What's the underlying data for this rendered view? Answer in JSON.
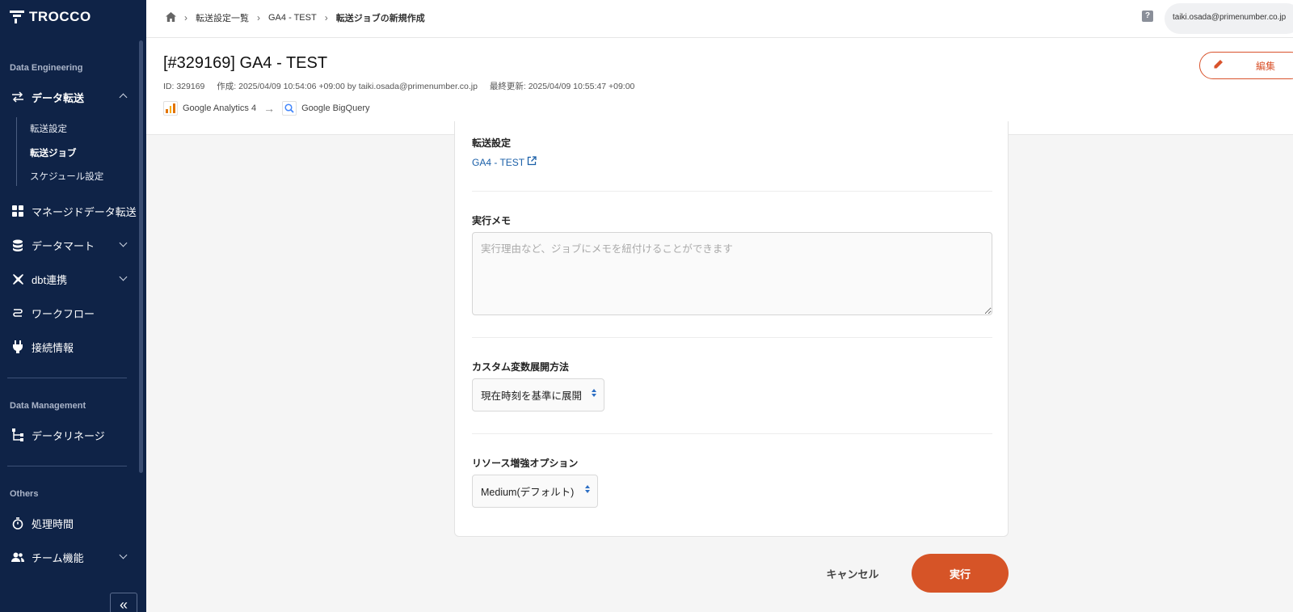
{
  "app": {
    "logo_text": "TROCCO"
  },
  "sidebar": {
    "section_data_engineering": "Data Engineering",
    "section_data_management": "Data Management",
    "section_others": "Others",
    "data_transfer": "データ転送",
    "sub_items": [
      "転送設定",
      "転送ジョブ",
      "スケジュール設定"
    ],
    "managed_transfer": "マネージドデータ転送",
    "data_mart": "データマート",
    "dbt": "dbt連携",
    "workflow": "ワークフロー",
    "connections": "接続情報",
    "lineage": "データリネージ",
    "processing_time": "処理時間",
    "team": "チーム機能",
    "collapse": "«"
  },
  "breadcrumb": {
    "items": [
      "転送設定一覧",
      "GA4 - TEST",
      "転送ジョブの新規作成"
    ]
  },
  "header": {
    "help": "?",
    "user_email": "taiki.osada@primenumber.co.jp",
    "title": "[#329169] GA4 - TEST",
    "meta_id": "ID: 329169",
    "meta_created": "作成: 2025/04/09 10:54:06 +09:00 by taiki.osada@primenumber.co.jp",
    "meta_updated": "最終更新: 2025/04/09 10:55:47 +09:00",
    "source": "Google Analytics 4",
    "destination": "Google BigQuery",
    "edit_label": "編集"
  },
  "form": {
    "transfer_setting_label": "転送設定",
    "transfer_setting_link": "GA4 - TEST",
    "memo_label": "実行メモ",
    "memo_placeholder": "実行理由など、ジョブにメモを紐付けることができます",
    "custom_var_label": "カスタム変数展開方法",
    "custom_var_value": "現在時刻を基準に展開",
    "resource_label": "リソース増強オプション",
    "resource_value": "Medium(デフォルト)",
    "cancel_label": "キャンセル",
    "run_label": "実行"
  },
  "colors": {
    "sidebar_bg": "#0f2347",
    "accent": "#d65427",
    "link": "#1a5fa8"
  }
}
